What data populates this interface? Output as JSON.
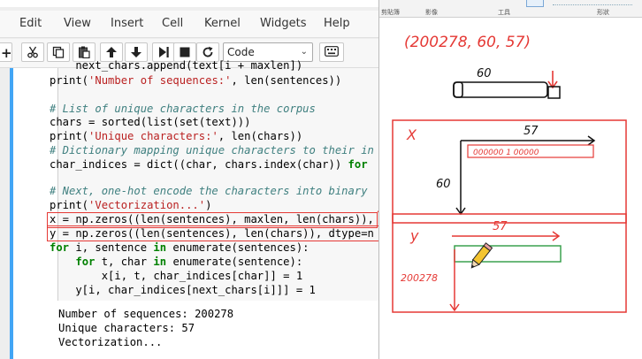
{
  "menubar": {
    "items": [
      "Edit",
      "View",
      "Insert",
      "Cell",
      "Kernel",
      "Widgets",
      "Help"
    ]
  },
  "toolbar": {
    "cell_type": "Code",
    "icons": [
      "add-cell-icon",
      "cut-icon",
      "copy-icon",
      "paste-icon",
      "move-up-icon",
      "move-down-icon",
      "run-icon",
      "stop-icon",
      "restart-icon",
      "keyboard-icon"
    ]
  },
  "code": {
    "lines": [
      "    next_chars.append(text[i + maxlen])",
      "print('Number of sequences:', len(sentences))",
      "",
      "# List of unique characters in the corpus",
      "chars = sorted(list(set(text)))",
      "print('Unique characters:', len(chars))",
      "# Dictionary mapping unique characters to their in",
      "char_indices = dict((char, chars.index(char)) for",
      "",
      "# Next, one-hot encode the characters into binary",
      "print('Vectorization...')",
      "x = np.zeros((len(sentences), maxlen, len(chars)),",
      "y = np.zeros((len(sentences), len(chars)), dtype=n",
      "for i, sentence in enumerate(sentences):",
      "    for t, char in enumerate(sentence):",
      "        x[i, t, char_indices[char]] = 1",
      "    y[i, char_indices[next_chars[i]]] = 1"
    ]
  },
  "output": {
    "lines": [
      "Number of sequences: 200278",
      "Unique characters: 57",
      "Vectorization..."
    ]
  },
  "paint": {
    "ribbon_labels": [
      "剪貼簿",
      "影像",
      "工具",
      "形狀"
    ],
    "note_shape": "(200278, 60, 57)",
    "label_60": "60",
    "label_57_a": "57",
    "label_x": "X",
    "tensor_x_text": "000000 1 00000",
    "label_60_b": "60",
    "label_y": "y",
    "label_57_b": "57",
    "label_200278": "200278"
  }
}
